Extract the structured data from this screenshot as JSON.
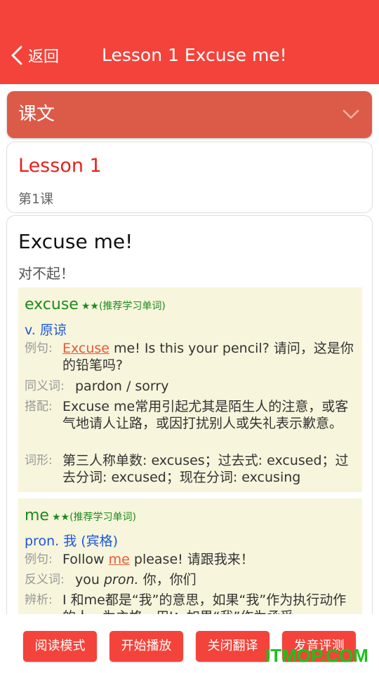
{
  "header": {
    "back_label": "返回",
    "title": "Lesson 1 Excuse me!",
    "bg_color": "#f4433a"
  },
  "dropdown": {
    "label": "课文",
    "icon": "chevron-down-icon"
  },
  "lesson": {
    "title": "Lesson 1",
    "subtitle": "第1课"
  },
  "sentence": {
    "english": "Excuse me!",
    "chinese": "对不起！"
  },
  "words": [
    {
      "word": "excuse",
      "stars": "★★",
      "tag": "(推荐学习单词)",
      "pos": "v. 原谅",
      "example_label": "例句:",
      "example_highlight": "Excuse",
      "example_rest": " me! Is this your pencil? 请问，这是你的铅笔吗?",
      "synonym_label": "同义词:",
      "synonym": "pardon / sorry",
      "collocation_label": "搭配:",
      "collocation": "Excuse me常用引起尤其是陌生人的注意，或客气地请人让路，或因打扰别人或失礼表示歉意。",
      "forms_label": "词形:",
      "forms": "第三人称单数: excuses；过去式: excused；过去分词: excused；现在分词: excusing"
    },
    {
      "word": "me",
      "stars": "★★",
      "tag": "(推荐学习单词)",
      "pos": "pron. 我 (宾格)",
      "example_label": "例句:",
      "example_before": "Follow ",
      "example_highlight": "me",
      "example_rest": " please! 请跟我来！",
      "antonym_label": "反义词:",
      "antonym_before": "you ",
      "antonym_pos": "pron.",
      "antonym_after": " 你，你们",
      "analysis_label": "辨析:",
      "analysis": "I 和me都是“我”的意思，如果“我”作为执行动作的人，为主格，用I；如果“我”作为承受"
    }
  ],
  "buttons": {
    "reading_mode": "阅读模式",
    "start_play": "开始播放",
    "close_translation": "关闭翻译",
    "pronunciation_eval": "发音评测"
  },
  "watermark": "ITMOP.COM"
}
